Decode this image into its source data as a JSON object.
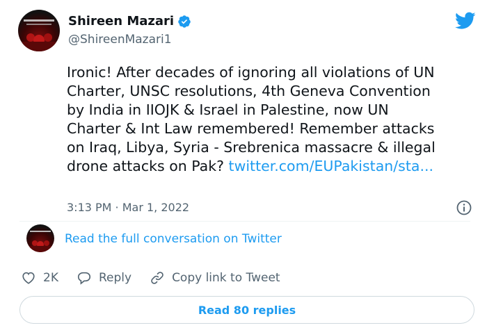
{
  "author": {
    "name": "Shireen Mazari",
    "handle": "@ShireenMazari1",
    "verified": true,
    "verified_icon": "verified-badge-icon"
  },
  "brand": {
    "icon": "twitter-bird-icon",
    "color": "#1d9bf0"
  },
  "tweet": {
    "lines": [
      "Ironic! After decades of ignoring all violations of UN",
      "Charter, UNSC resolutions, 4th Geneva Convention",
      "by India in IIOJK & Israel in Palestine, now UN",
      "Charter & Int Law remembered! Remember attacks",
      "on Iraq, Libya, Syria - Srebrenica massacre & illegal"
    ],
    "last_line_text": "drone attacks on Pak? ",
    "link_text": "twitter.com/EUPakistan/sta...",
    "timestamp": "3:13 PM · Mar 1, 2022"
  },
  "conversation": {
    "label": "Read the full conversation on Twitter"
  },
  "actions": {
    "like_count": "2K",
    "reply_label": "Reply",
    "copy_label": "Copy link to Tweet"
  },
  "replies": {
    "button_label": "Read 80 replies"
  },
  "colors": {
    "text": "#0f1419",
    "secondary": "#536471",
    "link": "#1d9bf0",
    "border": "#cfd9de"
  }
}
